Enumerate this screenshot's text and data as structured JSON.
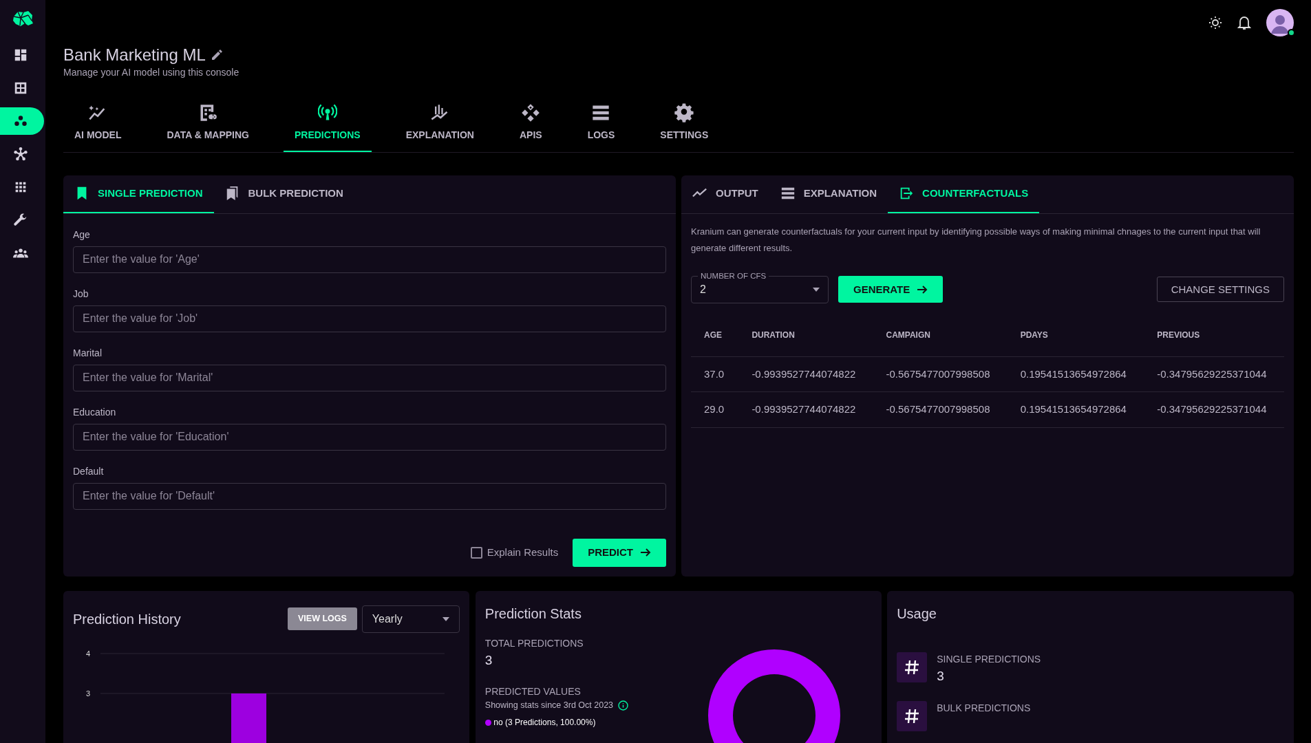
{
  "sidebar": {
    "items": [
      {
        "selected": false
      },
      {
        "selected": false
      },
      {
        "selected": true
      },
      {
        "selected": false
      },
      {
        "selected": false
      },
      {
        "selected": false
      },
      {
        "selected": false
      }
    ]
  },
  "header": {
    "title": "Bank Marketing ML",
    "subtitle": "Manage your AI model using this console"
  },
  "main_tabs": [
    {
      "label": "AI MODEL",
      "selected": false
    },
    {
      "label": "DATA & MAPPING",
      "selected": false
    },
    {
      "label": "PREDICTIONS",
      "selected": true
    },
    {
      "label": "EXPLANATION",
      "selected": false
    },
    {
      "label": "APIS",
      "selected": false
    },
    {
      "label": "LOGS",
      "selected": false
    },
    {
      "label": "SETTINGS",
      "selected": false
    }
  ],
  "input_panel": {
    "tabs": [
      {
        "label": "SINGLE PREDICTION",
        "selected": true
      },
      {
        "label": "BULK PREDICTION",
        "selected": false
      }
    ],
    "fields": [
      {
        "label": "Age",
        "placeholder": "Enter the value for 'Age'"
      },
      {
        "label": "Job",
        "placeholder": "Enter the value for 'Job'"
      },
      {
        "label": "Marital",
        "placeholder": "Enter the value for 'Marital'"
      },
      {
        "label": "Education",
        "placeholder": "Enter the value for 'Education'"
      },
      {
        "label": "Default",
        "placeholder": "Enter the value for 'Default'"
      }
    ],
    "explain": {
      "label": "Explain Results",
      "checked": false
    },
    "predict_button": "PREDICT"
  },
  "result_panel": {
    "tabs": [
      {
        "label": "OUTPUT",
        "selected": false
      },
      {
        "label": "EXPLANATION",
        "selected": false
      },
      {
        "label": "COUNTERFACTUALS",
        "selected": true
      }
    ],
    "description": "Kranium can generate counterfactuals for your current input by identifying possible ways of making minimal chnages to the current input that will generate different results.",
    "number_of_cfs": {
      "label": "NUMBER OF CFS",
      "value": "2"
    },
    "generate_button": "GENERATE",
    "change_settings_button": "CHANGE SETTINGS",
    "table": {
      "columns": [
        "AGE",
        "DURATION",
        "CAMPAIGN",
        "PDAYS",
        "PREVIOUS"
      ],
      "rows": [
        [
          "37.0",
          "-0.9939527744074822",
          "-0.5675477007998508",
          "0.19541513654972864",
          "-0.34795629225371044"
        ],
        [
          "29.0",
          "-0.9939527744074822",
          "-0.5675477007998508",
          "0.19541513654972864",
          "-0.34795629225371044"
        ]
      ]
    }
  },
  "prediction_history": {
    "title": "Prediction History",
    "view_logs_button": "VIEW LOGS",
    "period": "Yearly",
    "chart_data": {
      "type": "bar",
      "ylim": [
        0,
        4
      ],
      "yticks": [
        3,
        4
      ],
      "values": [
        3
      ]
    }
  },
  "prediction_stats": {
    "title": "Prediction Stats",
    "total_label": "TOTAL PREDICTIONS",
    "total_value": "3",
    "predicted_label": "PREDICTED VALUES",
    "since": "Showing stats since 3rd Oct 2023",
    "legend": [
      {
        "label": "no (3 Predictions, 100.00%)",
        "color": "#b000ff"
      }
    ]
  },
  "usage": {
    "title": "Usage",
    "items": [
      {
        "label": "SINGLE PREDICTIONS",
        "value": "3"
      },
      {
        "label": "BULK PREDICTIONS"
      }
    ]
  }
}
